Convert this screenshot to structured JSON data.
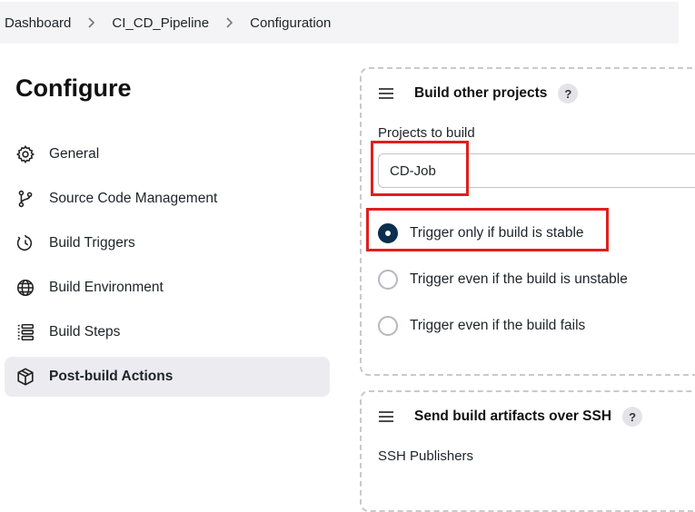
{
  "breadcrumb": {
    "items": [
      "Dashboard",
      "CI_CD_Pipeline",
      "Configuration"
    ]
  },
  "page": {
    "title": "Configure"
  },
  "sidebar": {
    "items": [
      {
        "label": "General",
        "icon": "gear-icon"
      },
      {
        "label": "Source Code Management",
        "icon": "branch-icon"
      },
      {
        "label": "Build Triggers",
        "icon": "clock-icon"
      },
      {
        "label": "Build Environment",
        "icon": "globe-icon"
      },
      {
        "label": "Build Steps",
        "icon": "list-icon"
      },
      {
        "label": "Post-build Actions",
        "icon": "package-icon",
        "active": true
      }
    ]
  },
  "build_other_projects": {
    "title": "Build other projects",
    "help": "?",
    "projects_label": "Projects to build",
    "projects_value": "CD-Job",
    "options": [
      {
        "label": "Trigger only if build is stable",
        "checked": true
      },
      {
        "label": "Trigger even if the build is unstable",
        "checked": false
      },
      {
        "label": "Trigger even if the build fails",
        "checked": false
      }
    ]
  },
  "ssh_artifacts": {
    "title": "Send build artifacts over SSH",
    "help": "?",
    "publishers_label": "SSH Publishers"
  },
  "colors": {
    "highlight": "#e01f1f",
    "radio_checked": "#0b2f4f",
    "active_sidebar_bg": "#ececf0"
  }
}
